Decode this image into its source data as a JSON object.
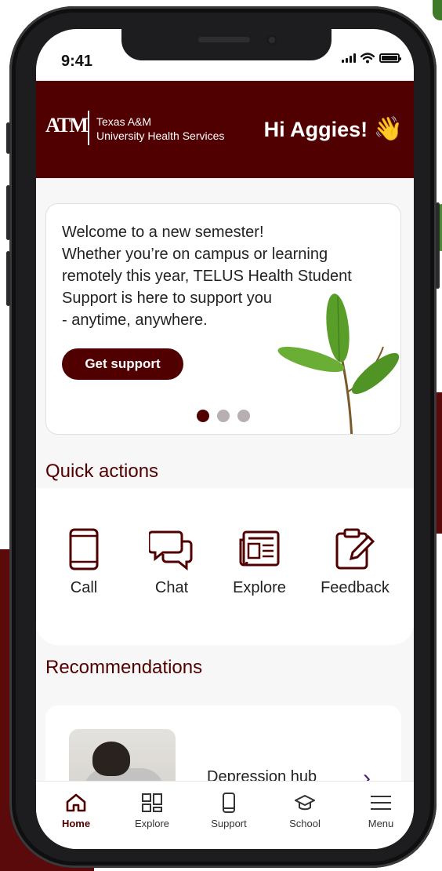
{
  "status_bar": {
    "time": "9:41"
  },
  "header": {
    "logo_mark": "ATM",
    "logo_line1": "Texas A&M",
    "logo_line2": "University Health Services",
    "greeting": "Hi Aggies!",
    "greeting_emoji": "👋"
  },
  "banner": {
    "lines": [
      "Welcome to a new semester!",
      "Whether you’re on campus or learning",
      "remotely this year, TELUS Health Student",
      "Support is here to support you",
      "- anytime, anywhere."
    ],
    "button_label": "Get support",
    "slide_count": 3,
    "active_slide": 1
  },
  "quick_actions": {
    "title": "Quick actions",
    "items": [
      {
        "label": "Call",
        "icon": "phone-icon"
      },
      {
        "label": "Chat",
        "icon": "chat-bubbles-icon"
      },
      {
        "label": "Explore",
        "icon": "newspaper-icon"
      },
      {
        "label": "Feedback",
        "icon": "clipboard-edit-icon"
      }
    ]
  },
  "recommendations": {
    "title": "Recommendations",
    "items": [
      {
        "title": "Depression hub",
        "icon": "chevron-right-icon"
      }
    ]
  },
  "tab_bar": {
    "tabs": [
      {
        "label": "Home",
        "icon": "home-icon",
        "active": true
      },
      {
        "label": "Explore",
        "icon": "grid-icon",
        "active": false
      },
      {
        "label": "Support",
        "icon": "phone-icon",
        "active": false
      },
      {
        "label": "School",
        "icon": "graduation-cap-icon",
        "active": false
      },
      {
        "label": "Menu",
        "icon": "hamburger-menu-icon",
        "active": false
      }
    ]
  },
  "colors": {
    "brand_maroon": "#500000",
    "accent_purple": "#4a1c6b",
    "background": "#f7f7f7"
  }
}
